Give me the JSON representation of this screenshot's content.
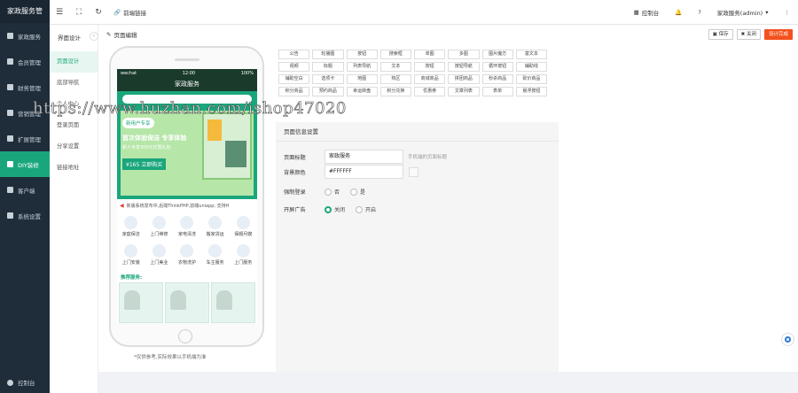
{
  "app": {
    "title": "家政服务管"
  },
  "sidebar": {
    "items": [
      {
        "label": "家政服务"
      },
      {
        "label": "会员管理"
      },
      {
        "label": "财务管理"
      },
      {
        "label": "营销管理"
      },
      {
        "label": "扩展管理"
      },
      {
        "label": "DIY装修"
      },
      {
        "label": "客户端"
      },
      {
        "label": "系统设置"
      }
    ],
    "bottom_label": "控制台"
  },
  "topbar": {
    "frontend_link": "前端链接",
    "console": "控制台",
    "user": "家政服务(admin)"
  },
  "subnav": {
    "title": "界面设计",
    "items": [
      {
        "label": "页面设计"
      },
      {
        "label": "底部导航"
      },
      {
        "label": "个人中心"
      },
      {
        "label": "登录页面"
      },
      {
        "label": "分享设置"
      },
      {
        "label": "链接地址"
      }
    ]
  },
  "editor": {
    "page_title": "页面编辑",
    "buttons": {
      "save": "保存",
      "close": "关闭",
      "publish": "设计完成"
    },
    "phone": {
      "carrier": "wechat",
      "time": "12:00",
      "battery": "100%",
      "app_title": "家政服务",
      "banner_tag": "新用户专享",
      "banner_headline": "首次体验保洁 专享体验",
      "banner_sub": "新人专享300元优惠礼包",
      "banner_price": "¥165",
      "banner_btn": "立即购买",
      "notice": "新版系统发布中,后端ThinkPHP,前端uniapp; 支持H",
      "services": [
        "家庭保洁",
        "上门维修",
        "家电清洗",
        "搬家货运",
        "保姆月嫂",
        "上门安装",
        "上门美业",
        "衣物洗护",
        "车主服务",
        "上门服务"
      ],
      "recommend": "推荐服务:",
      "footnote": "*仅供参考,实际效果以手机端为准"
    },
    "components": [
      "公告",
      "轮播图",
      "按钮",
      "搜索框",
      "单图",
      "多图",
      "图片魔方",
      "富文本",
      "视频",
      "标题",
      "列表导航",
      "文本",
      "按钮",
      "按钮导航",
      "循环按钮",
      "辅助线",
      "辅助空白",
      "选项卡",
      "地图",
      "热区",
      "商城商品",
      "拼团商品",
      "秒杀商品",
      "砍价商品",
      "积分商品",
      "预约商品",
      "幸运转盘",
      "积分兑换",
      "优惠券",
      "文章列表",
      "表单",
      "悬浮按钮"
    ],
    "settings": {
      "header": "页面信息设置",
      "title_label": "页面标题",
      "title_value": "家政服务",
      "title_hint": "手机端的页面标题",
      "bg_label": "背景颜色",
      "bg_value": "#FFFFFF",
      "login_label": "强制登录",
      "login_options": [
        "否",
        "是"
      ],
      "ad_label": "开屏广告",
      "ad_options": [
        "关闭",
        "开启"
      ]
    }
  },
  "watermark": "https://www.huzhan.com/ishop47020",
  "colors": {
    "accent": "#1aa67c",
    "sidebar": "#1f2d3a",
    "publish": "#f4511e"
  }
}
